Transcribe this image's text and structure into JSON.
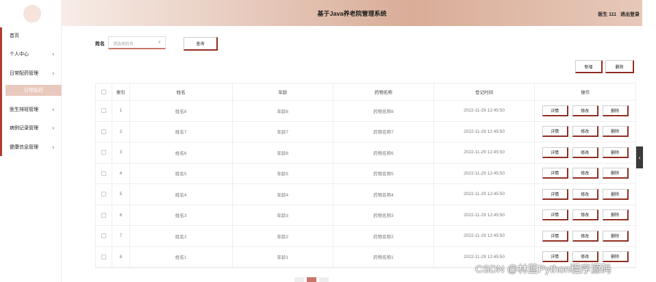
{
  "header": {
    "title": "基于Java养老院管理系统",
    "user_label": "医生 111",
    "logout_label": "退出登录"
  },
  "sidebar": {
    "items": [
      {
        "label": "首页",
        "has_chevron": false
      },
      {
        "label": "个人中心",
        "chevron": "∨"
      },
      {
        "label": "日常配药管理",
        "chevron": "∧"
      },
      {
        "label": "医生排班管理",
        "chevron": "∨"
      },
      {
        "label": "病例记录管理",
        "chevron": "∨"
      },
      {
        "label": "健康信息管理",
        "chevron": "∨"
      }
    ],
    "active_sub": "日常配药"
  },
  "search": {
    "label": "姓名",
    "placeholder": "请选择姓名",
    "query_label": "查询"
  },
  "actions": {
    "add_label": "新增",
    "delete_label": "删除"
  },
  "table": {
    "headers": [
      "索引",
      "姓名",
      "年龄",
      "药物名称",
      "登记时间",
      "操作"
    ],
    "op_labels": {
      "detail": "详情",
      "edit": "修改",
      "delete": "删除"
    },
    "rows": [
      {
        "idx": "1",
        "name": "姓名8",
        "age": "年龄8",
        "drug": "药物名称8",
        "time": "2022-11-29 12:45:50"
      },
      {
        "idx": "2",
        "name": "姓名7",
        "age": "年龄7",
        "drug": "药物名称7",
        "time": "2022-11-29 12:45:50"
      },
      {
        "idx": "3",
        "name": "姓名6",
        "age": "年龄6",
        "drug": "药物名称6",
        "time": "2022-11-29 12:45:50"
      },
      {
        "idx": "4",
        "name": "姓名5",
        "age": "年龄5",
        "drug": "药物名称5",
        "time": "2022-11-29 12:45:50"
      },
      {
        "idx": "5",
        "name": "姓名4",
        "age": "年龄4",
        "drug": "药物名称4",
        "time": "2022-11-29 12:45:50"
      },
      {
        "idx": "6",
        "name": "姓名3",
        "age": "年龄3",
        "drug": "药物名称3",
        "time": "2022-11-29 12:45:50"
      },
      {
        "idx": "7",
        "name": "姓名2",
        "age": "年龄2",
        "drug": "药物名称2",
        "time": "2022-11-29 12:45:50"
      },
      {
        "idx": "8",
        "name": "姓名1",
        "age": "年龄1",
        "drug": "药物名称1",
        "time": "2022-11-29 12:45:50"
      }
    ]
  },
  "watermark": "CSDN @林蓝Python程序源码",
  "colors": {
    "accent": "#b23a2e",
    "header_mid": "#d9ad98",
    "active_bg": "#e9c9bd"
  }
}
